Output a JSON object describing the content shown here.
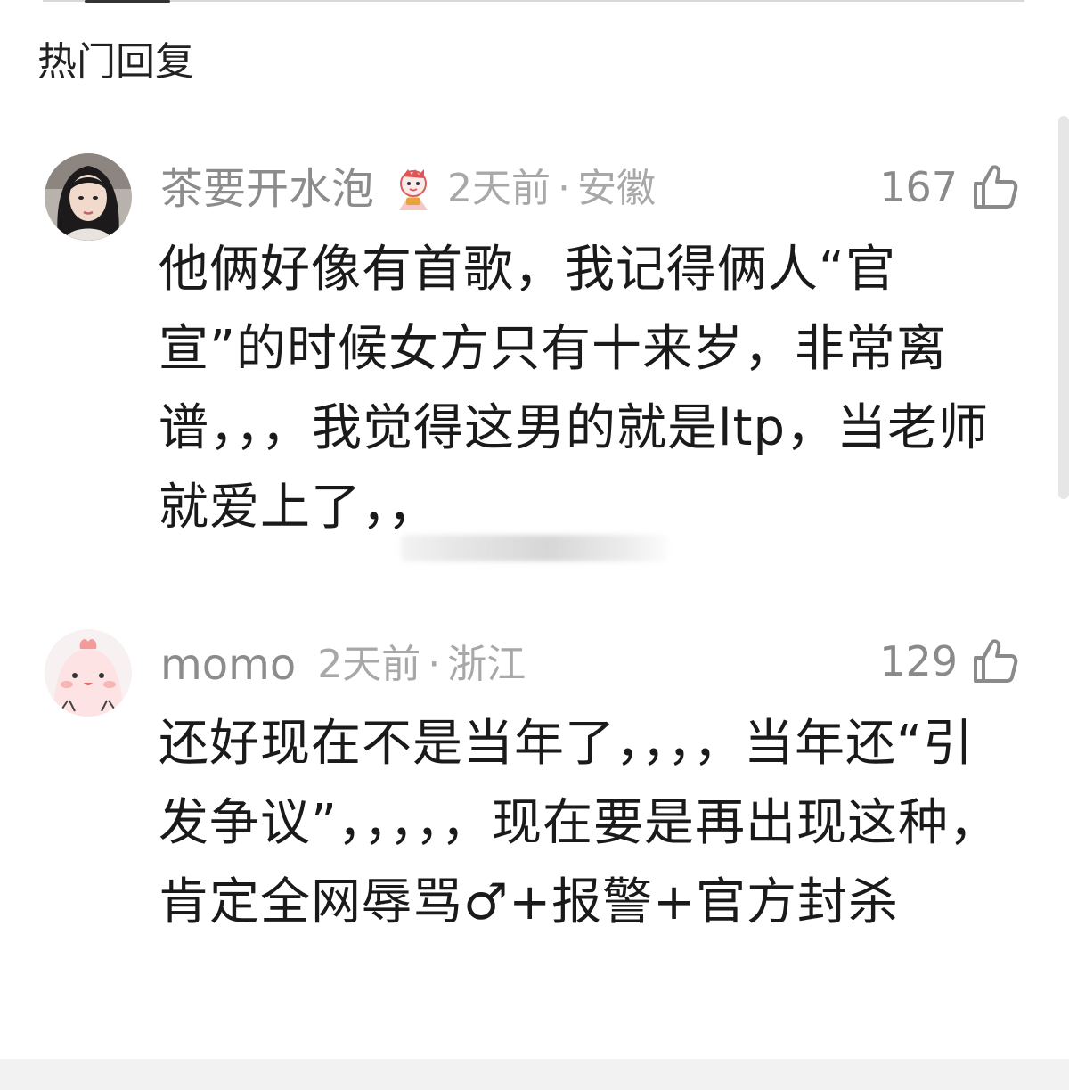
{
  "section": {
    "title": "热门回复"
  },
  "comments": [
    {
      "username": "茶要开水泡",
      "time": "2天前",
      "separator": "·",
      "location": "安徽",
      "likes": "167",
      "text": "他俩好像有首歌，我记得俩人“官宣”的时候女方只有十来岁，非常离谱，，，我觉得这男的就是ltp，当老师就爱上了，，",
      "avatar_icon": "girl-portrait-avatar",
      "badge_icon": "mascot-badge-icon"
    },
    {
      "username": "momo",
      "time": "2天前",
      "separator": "·",
      "location": "浙江",
      "likes": "129",
      "text": "还好现在不是当年了，，，，当年还“引发争议”，，，，，现在要是再出现这种，肯定全网辱骂♂+报警+官方封杀",
      "avatar_icon": "pink-blob-avatar"
    }
  ],
  "colors": {
    "meta_text": "#a8a8a8",
    "username_text": "#8c8c8c",
    "body_text": "#1a1a1a"
  }
}
